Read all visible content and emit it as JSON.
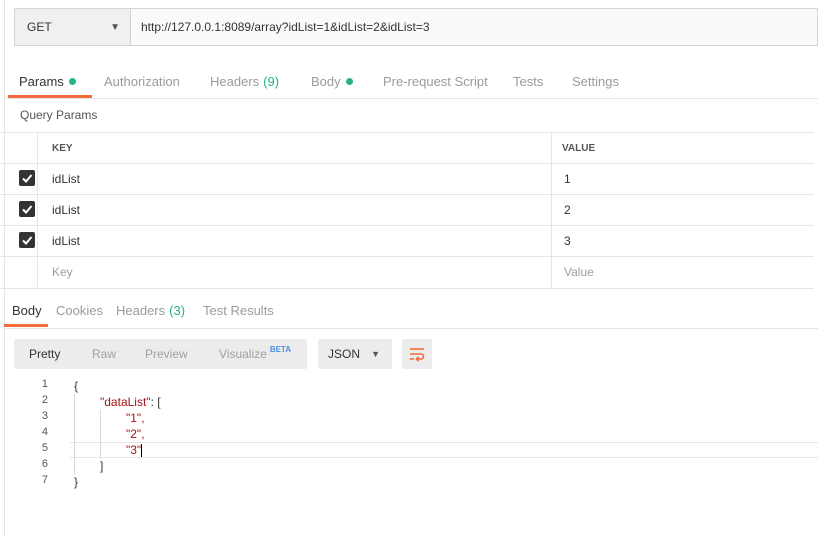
{
  "request": {
    "method": "GET",
    "url": "http://127.0.0.1:8089/array?idList=1&idList=2&idList=3"
  },
  "request_tabs": [
    {
      "label": "Params",
      "indicator": "dot"
    },
    {
      "label": "Authorization"
    },
    {
      "label": "Headers",
      "count": "(9)"
    },
    {
      "label": "Body",
      "indicator": "dot"
    },
    {
      "label": "Pre-request Script"
    },
    {
      "label": "Tests"
    },
    {
      "label": "Settings"
    }
  ],
  "params": {
    "section_title": "Query Params",
    "headers": {
      "key": "KEY",
      "value": "VALUE"
    },
    "rows": [
      {
        "checked": true,
        "key": "idList",
        "value": "1"
      },
      {
        "checked": true,
        "key": "idList",
        "value": "2"
      },
      {
        "checked": true,
        "key": "idList",
        "value": "3"
      }
    ],
    "placeholder": {
      "key": "Key",
      "value": "Value"
    }
  },
  "response_tabs": [
    {
      "label": "Body"
    },
    {
      "label": "Cookies"
    },
    {
      "label": "Headers",
      "count": "(3)"
    },
    {
      "label": "Test Results"
    }
  ],
  "view_modes": [
    "Pretty",
    "Raw",
    "Preview",
    "Visualize"
  ],
  "visualize_badge": "BETA",
  "format": "JSON",
  "code": {
    "line_numbers": [
      "1",
      "2",
      "3",
      "4",
      "5",
      "6",
      "7"
    ],
    "lines": [
      "{",
      "\"dataList\": [",
      "\"1\",",
      "\"2\",",
      "\"3\"",
      "]",
      "}"
    ]
  },
  "colors": {
    "accent": "#f26b3a",
    "indicator": "#26b47f",
    "beta": "#4a90e2"
  }
}
